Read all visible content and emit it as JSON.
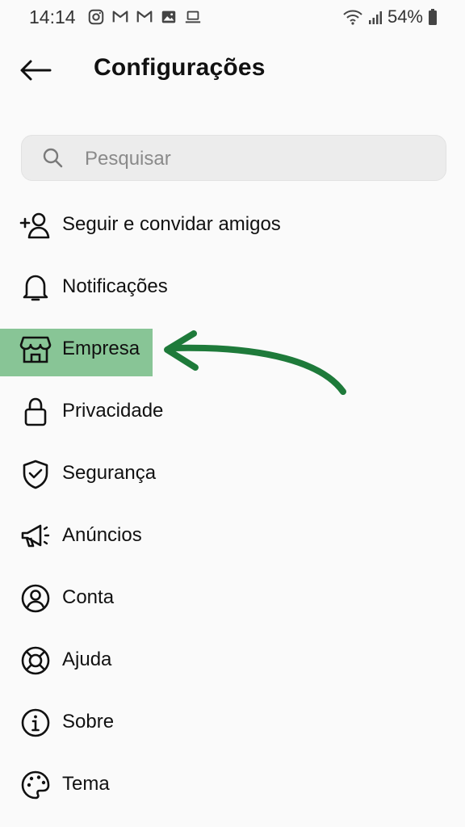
{
  "status_bar": {
    "time": "14:14",
    "battery": "54%",
    "left_icons": [
      "instagram-icon",
      "gmail-icon",
      "gmail-icon",
      "gallery-icon",
      "laptop-icon"
    ],
    "right_icons": [
      "wifi-icon",
      "signal-icon",
      "battery-icon"
    ]
  },
  "header": {
    "title": "Configurações",
    "back_icon": "arrow-left-icon"
  },
  "search": {
    "placeholder": "Pesquisar",
    "value": ""
  },
  "menu": {
    "items": [
      {
        "label": "Seguir e convidar amigos",
        "icon": "add-person-icon"
      },
      {
        "label": "Notificações",
        "icon": "bell-icon"
      },
      {
        "label": "Empresa",
        "icon": "store-icon",
        "highlighted": true
      },
      {
        "label": "Privacidade",
        "icon": "lock-icon"
      },
      {
        "label": "Segurança",
        "icon": "shield-check-icon"
      },
      {
        "label": "Anúncios",
        "icon": "megaphone-icon"
      },
      {
        "label": "Conta",
        "icon": "account-circle-icon"
      },
      {
        "label": "Ajuda",
        "icon": "lifebuoy-icon"
      },
      {
        "label": "Sobre",
        "icon": "info-icon"
      },
      {
        "label": "Tema",
        "icon": "palette-icon"
      }
    ]
  },
  "colors": {
    "highlight": "#7bbf8b",
    "arrow": "#1e7a3a",
    "background": "#fafafa",
    "search_bg": "#ececec"
  }
}
